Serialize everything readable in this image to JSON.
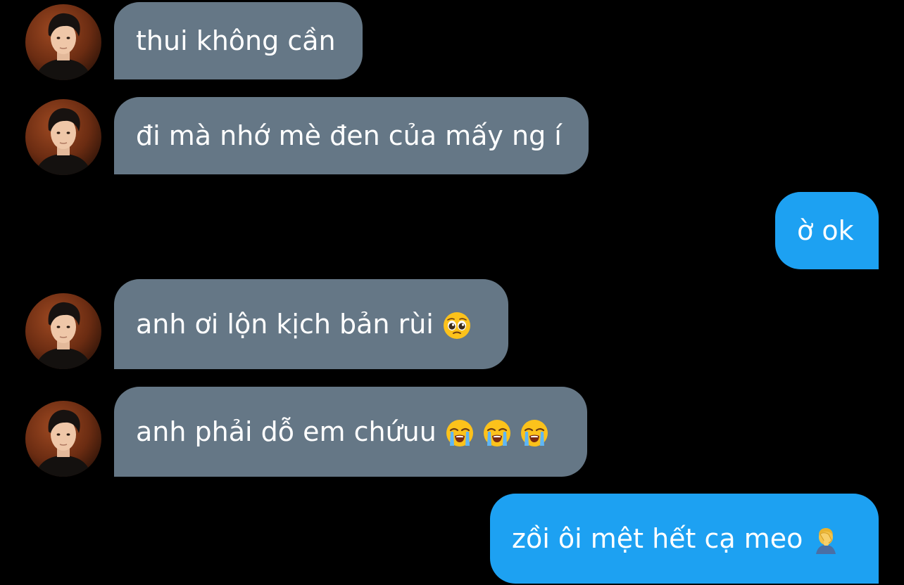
{
  "conversation": {
    "messages": [
      {
        "side": "incoming",
        "text": "thui không cần",
        "avatar": "contact-avatar"
      },
      {
        "side": "incoming",
        "text": "đi mà nhớ mè đen của mấy ng í",
        "avatar": "contact-avatar"
      },
      {
        "side": "outgoing",
        "text": "ờ ok"
      },
      {
        "side": "incoming",
        "text": "anh ơi lộn kịch bản rùi",
        "avatar": "contact-avatar",
        "emojis": [
          "pleading-face-emoji"
        ]
      },
      {
        "side": "incoming",
        "text": "anh phải dỗ em chứuu",
        "avatar": "contact-avatar",
        "emojis": [
          "loudly-crying-face-emoji",
          "loudly-crying-face-emoji",
          "loudly-crying-face-emoji"
        ]
      },
      {
        "side": "outgoing",
        "text": "zồi ôi mệt hết cạ meo",
        "emojis": [
          "face-palm-emoji"
        ]
      }
    ]
  },
  "colors": {
    "background": "#000000",
    "incoming_bubble": "#657786",
    "outgoing_bubble": "#1da1f2",
    "text": "#ffffff"
  }
}
